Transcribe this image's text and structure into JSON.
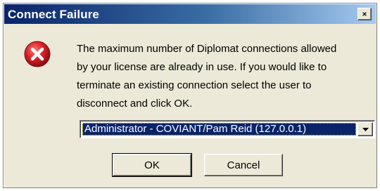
{
  "dialog": {
    "title": "Connect Failure",
    "close_label": "X",
    "message": "The maximum number of Diplomat connections allowed\nby your license are already in use.  If you would like to\nterminate an existing connection select the user to\ndisconnect and click OK.",
    "icon": "error-icon",
    "connection_select": {
      "selected": "Administrator - COVIANT/Pam Reid (127.0.0.1)"
    },
    "buttons": {
      "ok": "OK",
      "cancel": "Cancel"
    }
  },
  "colors": {
    "titlebar_start": "#0a246a",
    "titlebar_end": "#a6caf0",
    "dialog_bg": "#ece9d8",
    "error_red": "#d8202a",
    "selection_bg": "#0a246a"
  }
}
